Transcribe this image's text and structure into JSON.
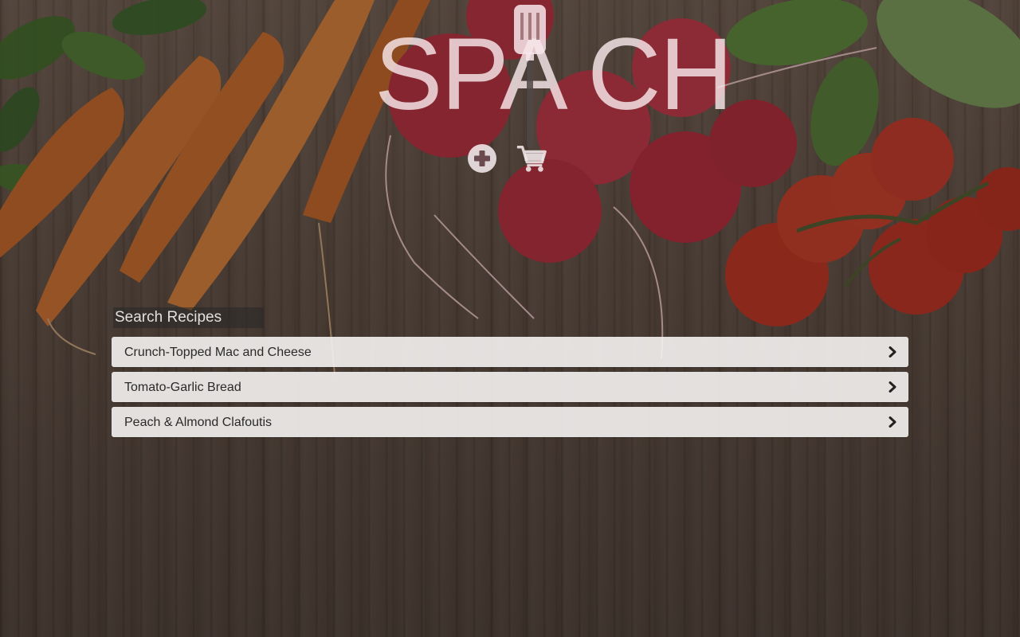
{
  "app": {
    "logo_text": "SPA  CH"
  },
  "actions": {
    "add_icon": "plus-circle-icon",
    "cart_icon": "shopping-cart-icon"
  },
  "search": {
    "placeholder": "Search Recipes",
    "value": ""
  },
  "recipes": [
    {
      "title": "Crunch-Topped Mac and Cheese",
      "icon": "chevron-right-icon"
    },
    {
      "title": "Tomato-Garlic Bread",
      "icon": "chevron-right-icon"
    },
    {
      "title": "Peach & Almond Clafoutis",
      "icon": "chevron-right-icon"
    }
  ],
  "colors": {
    "list_bg": "#f5f3f2",
    "text": "#2a2a2a",
    "icon_light": "#efe6e8"
  }
}
